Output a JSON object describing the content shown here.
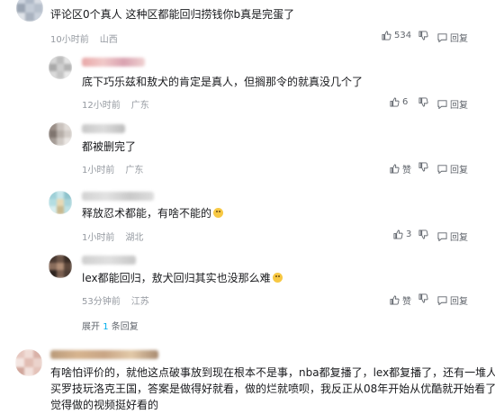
{
  "top_comment": {
    "text": "评论区0个真人 这种区都能回归捞钱你b真是完蛋了",
    "time": "10小时前",
    "location": "山西",
    "like_count": "534",
    "reply_label": "回复"
  },
  "replies": [
    {
      "text": "底下巧乐兹和敖犬的肯定是真人，但搁那令的就真没几个了",
      "time": "12小时前",
      "location": "广东",
      "like_count": "6",
      "reply_label": "回复"
    },
    {
      "text": "都被删完了",
      "time": "1小时前",
      "location": "广东",
      "like_label": "赞",
      "reply_label": "回复"
    },
    {
      "text": "释放忍术都能，有啥不能的",
      "time": "1小时前",
      "location": "湖北",
      "like_count": "3",
      "reply_label": "回复"
    },
    {
      "text": "lex都能回归，敖犬回归其实也没那么难",
      "time": "53分钟前",
      "location": "江苏",
      "like_label": "赞",
      "reply_label": "回复"
    }
  ],
  "expand": {
    "prefix": "展开",
    "count": "1",
    "suffix": "条回复"
  },
  "bottom_comment": {
    "lines": [
      "有啥怕评价的，就他这点破事放到现在根本不是事，nba都复播了，lex都复播了，还有一堆人",
      "买罗技玩洛克王国，答案是做得好就看，做的烂就喷呗，我反正从08年开始从优酷就开始看了，",
      "觉得做的视频挺好看的"
    ]
  },
  "colors": {
    "text": "#18191c",
    "meta": "#9499a0",
    "action": "#61666d",
    "link": "#00aeec"
  },
  "icons": {
    "like": "thumbs-up-icon",
    "dislike": "thumbs-down-icon",
    "reply": "reply-icon",
    "emoji": "emoji-icon"
  }
}
